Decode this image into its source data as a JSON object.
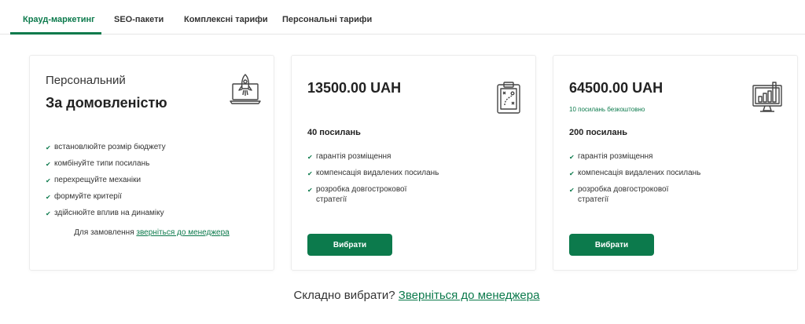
{
  "tabs": [
    {
      "label": "Крауд-маркетинг",
      "active": true
    },
    {
      "label": "SEO-пакети",
      "active": false
    },
    {
      "label": "Комплексні тарифи",
      "active": false
    },
    {
      "label": "Персональні тарифи",
      "active": false
    }
  ],
  "cards": [
    {
      "subtitle": "Персональний",
      "title": "За домовленістю",
      "icon": "rocket-laptop-icon",
      "features": [
        "встановлюйте розмір бюджету",
        "комбінуйте типи посилань",
        "перехрещуйте механіки",
        "формуйте критерії",
        "здійснюйте вплив на динаміку"
      ],
      "order_prefix": "Для замовлення",
      "order_link": "зверніться до менеджера"
    },
    {
      "price": "13500.00 UAH",
      "icon": "strategy-clipboard-icon",
      "links_count": "40 посилань",
      "features": [
        "гарантія розміщення",
        "компенсація видалених посилань",
        "розробка довгострокової стратегії"
      ],
      "button_label": "Вибрати"
    },
    {
      "price": "64500.00 UAH",
      "free_note": "10 посилань безкоштовно",
      "icon": "analytics-monitor-icon",
      "links_count": "200 посилань",
      "features": [
        "гарантія розміщення",
        "компенсація видалених посилань",
        "розробка довгострокової стратегії"
      ],
      "button_label": "Вибрати"
    }
  ],
  "bottom": {
    "question": "Складно вибрати?",
    "link": "Зверніться до менеджера"
  },
  "colors": {
    "accent": "#0c7a4c",
    "text": "#333333",
    "border": "#ececec"
  }
}
